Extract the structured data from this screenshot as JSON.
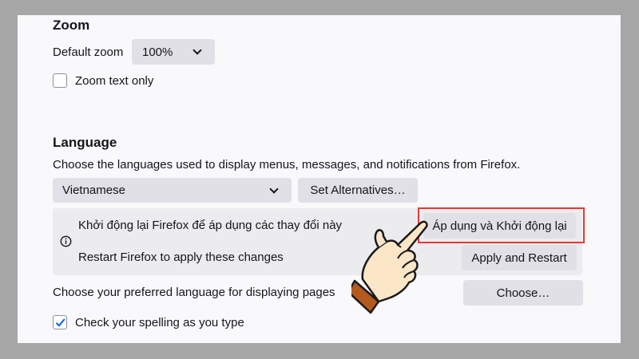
{
  "zoom": {
    "heading": "Zoom",
    "default_zoom_label": "Default zoom",
    "default_zoom_value": "100%",
    "zoom_text_only_label": "Zoom text only",
    "zoom_text_only_checked": false
  },
  "language": {
    "heading": "Language",
    "description": "Choose the languages used to display menus, messages, and notifications from Firefox.",
    "selected_language": "Vietnamese",
    "set_alternatives_label": "Set Alternatives…",
    "notice": {
      "message_vi": "Khởi động lại Firefox để áp dụng các thay đổi này",
      "button_vi": "Áp dụng và Khởi động lại",
      "message_en": "Restart Firefox to apply these changes",
      "button_en": "Apply and Restart"
    },
    "preferred_pages_label": "Choose your preferred language for displaying pages",
    "choose_label": "Choose…",
    "spellcheck_label": "Check your spelling as you type",
    "spellcheck_checked": true
  },
  "colors": {
    "highlight": "#e53935",
    "hand_skin": "#fbe6c8",
    "hand_cuff": "#b55a1e",
    "check": "#0061e0"
  },
  "icons": {
    "info": "info-circle-icon",
    "pointer": "pointing-hand-icon"
  }
}
